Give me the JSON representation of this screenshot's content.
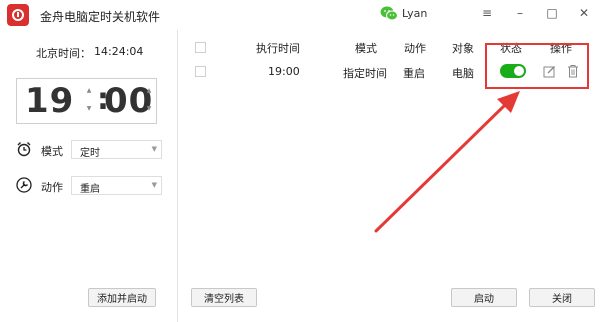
{
  "window": {
    "title": "金舟电脑定时关机软件",
    "user": "Lyan",
    "controls": {
      "menu": "≡",
      "minimize": "–",
      "maximize": "□",
      "close": "✕"
    }
  },
  "left": {
    "clock_label": "北京时间：",
    "clock_value": "14:24:04",
    "hour": "19",
    "colon": ":",
    "minute": "00",
    "up_arrow": "▲",
    "down_arrow": "▼",
    "mode_label": "模式",
    "mode_value": "定时",
    "action_label": "动作",
    "action_value": "重启",
    "caret": "▼",
    "add_button": "添加并启动"
  },
  "table": {
    "headers": [
      "执行时间",
      "模式",
      "动作",
      "对象",
      "状态",
      "操作"
    ],
    "rows": [
      {
        "time": "19:00",
        "mode": "指定时间",
        "action": "重启",
        "target": "电脑",
        "status_on": true
      }
    ]
  },
  "footer": {
    "clear_button": "清空列表",
    "start_button": "启动",
    "close_button": "关闭"
  },
  "colors": {
    "brand": "#d92f2f",
    "toggle_on": "#1aad19",
    "annotation": "#e53935",
    "wechat": "#4cbf3a"
  },
  "icons": {
    "logo": "power-logo-icon",
    "wechat": "wechat-icon",
    "mode": "alarm-clock-icon",
    "action": "wrench-icon",
    "edit": "edit-icon",
    "delete": "trash-icon"
  }
}
